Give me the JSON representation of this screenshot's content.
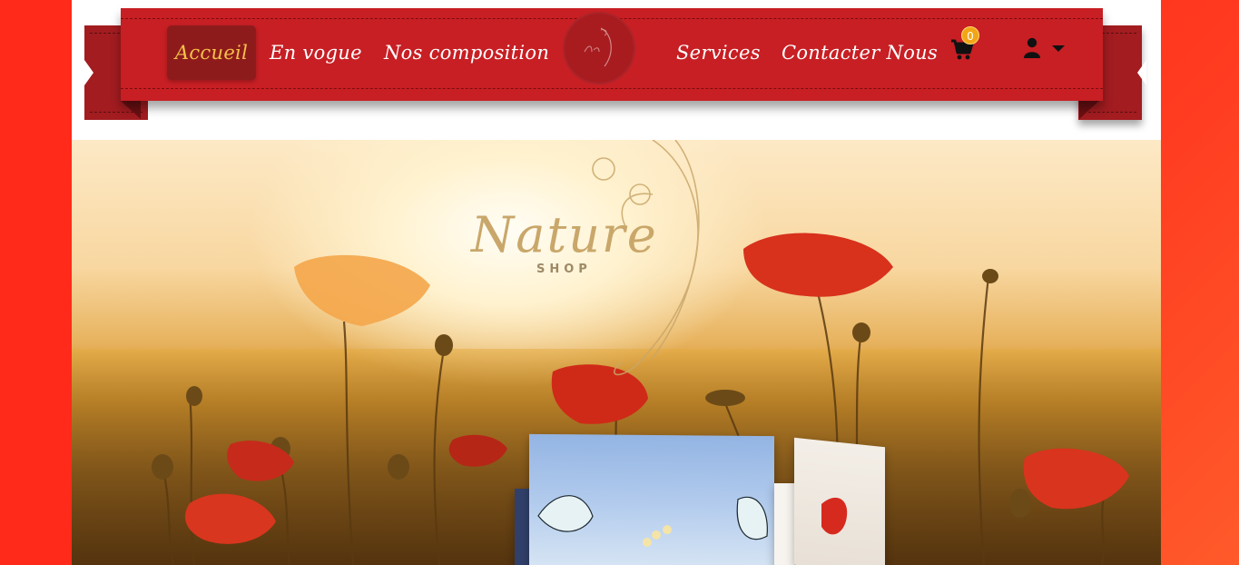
{
  "nav": {
    "items": [
      {
        "label": "Accueil",
        "active": true
      },
      {
        "label": "En vogue",
        "active": false
      },
      {
        "label": "Nos composition",
        "active": false
      },
      {
        "label": "Services",
        "active": false
      },
      {
        "label": "Contacter Nous",
        "active": false
      }
    ],
    "logo_icon": "nature-shop-logo",
    "cart": {
      "icon": "shopping-cart-icon",
      "count": "0"
    },
    "user": {
      "icon": "user-icon",
      "dropdown_icon": "caret-down-icon"
    }
  },
  "hero": {
    "brand": "Nature",
    "brand_sub": "SHOP"
  },
  "colors": {
    "nav_red": "#c71f24",
    "ribbon_dark": "#a21c20",
    "active_bg": "#8e1b1c",
    "active_text": "#f4c24a",
    "badge": "#f2a516",
    "background": "#ff2a1a"
  }
}
